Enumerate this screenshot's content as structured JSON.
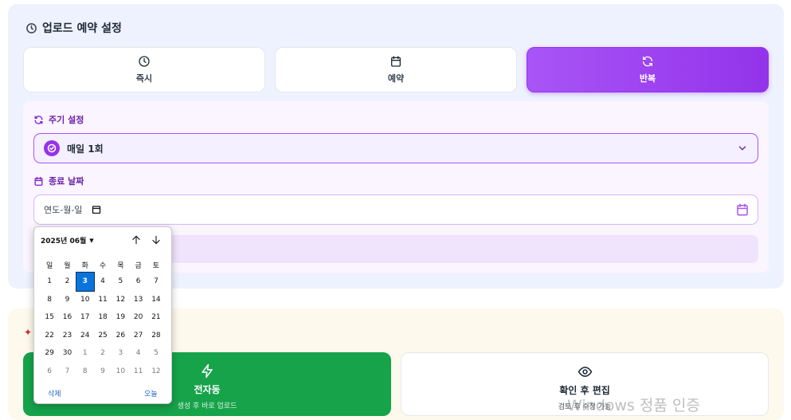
{
  "section": {
    "title": "업로드 예약 설정",
    "title_icon": "clock-icon"
  },
  "modes": [
    {
      "label": "즉시",
      "icon": "clock-icon",
      "active": false
    },
    {
      "label": "예약",
      "icon": "calendar-icon",
      "active": false
    },
    {
      "label": "반복",
      "icon": "refresh-icon",
      "active": true
    }
  ],
  "repeat": {
    "cycle_label": "주기 설정",
    "cycle_value": "매일 1회",
    "end_label": "종료 날짜",
    "end_placeholder": "연도-월-일"
  },
  "picker": {
    "month_label": "2025년 06월",
    "weekdays": [
      "일",
      "월",
      "화",
      "수",
      "목",
      "금",
      "토"
    ],
    "weeks": [
      [
        "1",
        "2",
        "3",
        "4",
        "5",
        "6",
        "7"
      ],
      [
        "8",
        "9",
        "10",
        "11",
        "12",
        "13",
        "14"
      ],
      [
        "15",
        "16",
        "17",
        "18",
        "19",
        "20",
        "21"
      ],
      [
        "22",
        "23",
        "24",
        "25",
        "26",
        "27",
        "28"
      ],
      [
        "29",
        "30",
        "1",
        "2",
        "3",
        "4",
        "5"
      ],
      [
        "6",
        "7",
        "8",
        "9",
        "10",
        "11",
        "12"
      ]
    ],
    "selected_day": "3",
    "clear_label": "삭제",
    "today_label": "오늘"
  },
  "actions": [
    {
      "title": "전자동",
      "subtitle": "생성 후 바로 업로드",
      "icon": "lightning-icon"
    },
    {
      "title": "확인 후 편집",
      "subtitle": "검토 후 수정 가능",
      "icon": "eye-icon"
    }
  ],
  "colors": {
    "accent": "#9333ea",
    "green": "#16a34a",
    "selected": "#0a74dc"
  },
  "watermark": "Windows 정품 인증"
}
